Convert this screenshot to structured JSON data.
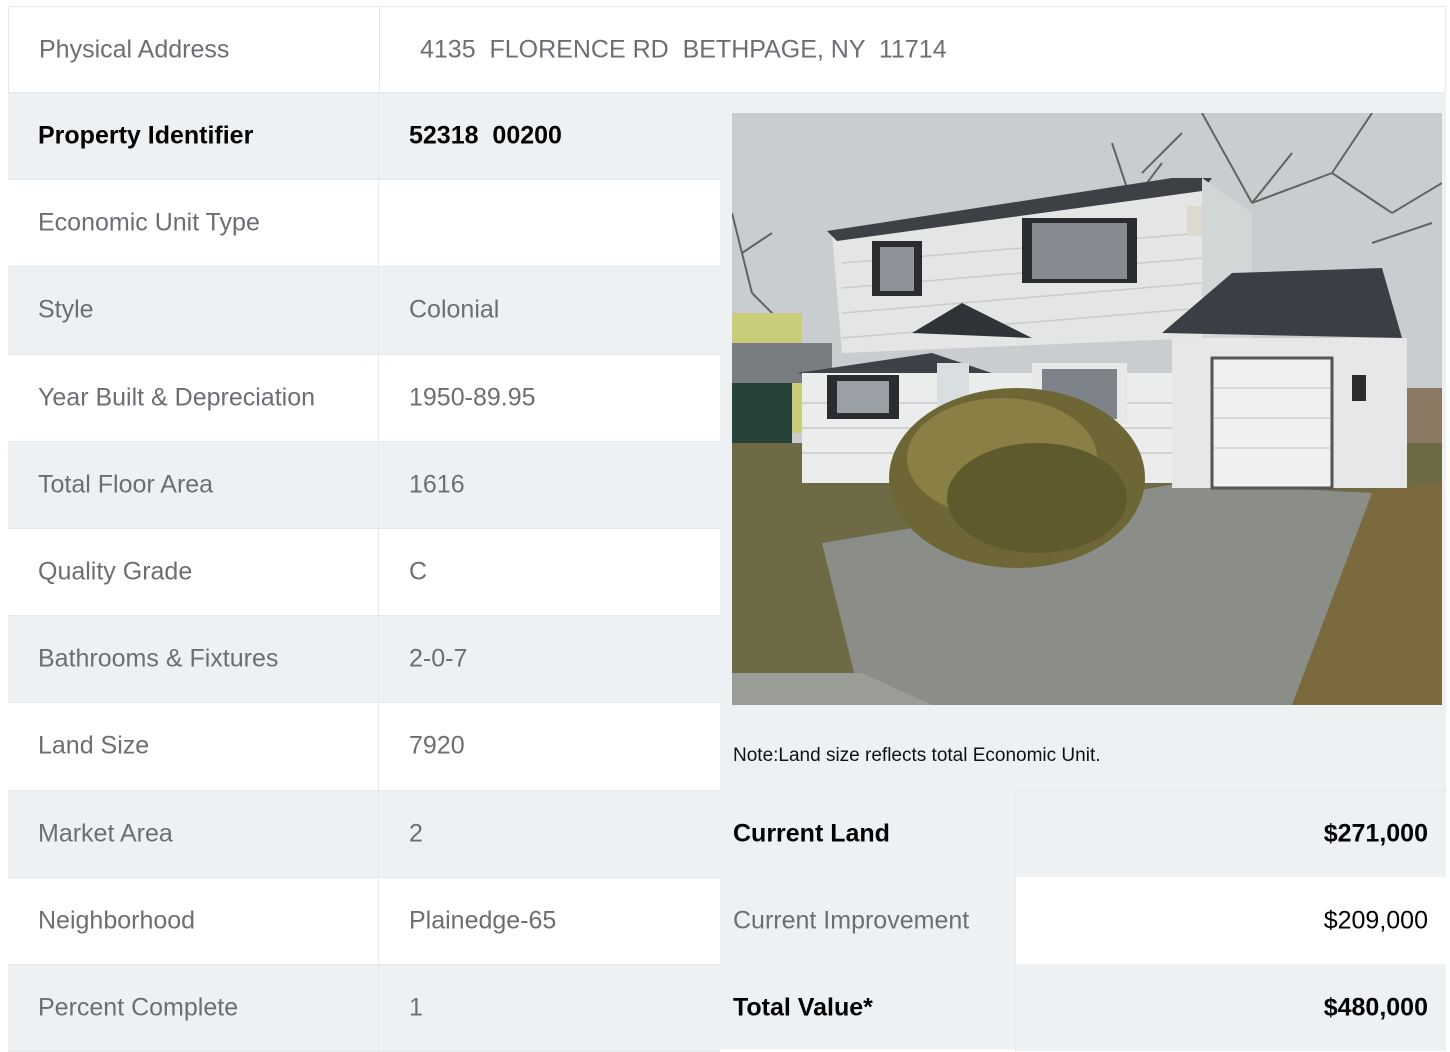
{
  "address": {
    "label": "Physical Address",
    "value": "4135  FLORENCE RD  BETHPAGE, NY  11714"
  },
  "details": [
    {
      "label": "Property Identifier",
      "value": "52318  00200",
      "bold": true
    },
    {
      "label": "Economic Unit Type",
      "value": ""
    },
    {
      "label": "Style",
      "value": "Colonial"
    },
    {
      "label": "Year Built & Depreciation",
      "value": "1950-89.95"
    },
    {
      "label": "Total Floor Area",
      "value": "1616"
    },
    {
      "label": "Quality Grade",
      "value": "C"
    },
    {
      "label": "Bathrooms & Fixtures",
      "value": "2-0-7"
    },
    {
      "label": "Land Size",
      "value": "7920"
    },
    {
      "label": "Market Area",
      "value": "2"
    },
    {
      "label": "Neighborhood",
      "value": "Plainedge-65"
    },
    {
      "label": "Percent Complete",
      "value": "1"
    }
  ],
  "note": "Note:Land size reflects total Economic Unit.",
  "valuation": {
    "land": {
      "label": "Current Land",
      "value": "$271,000"
    },
    "improvement": {
      "label": "Current Improvement",
      "value": "$209,000"
    },
    "total": {
      "label": "Total Value*",
      "value": "$480,000"
    }
  }
}
